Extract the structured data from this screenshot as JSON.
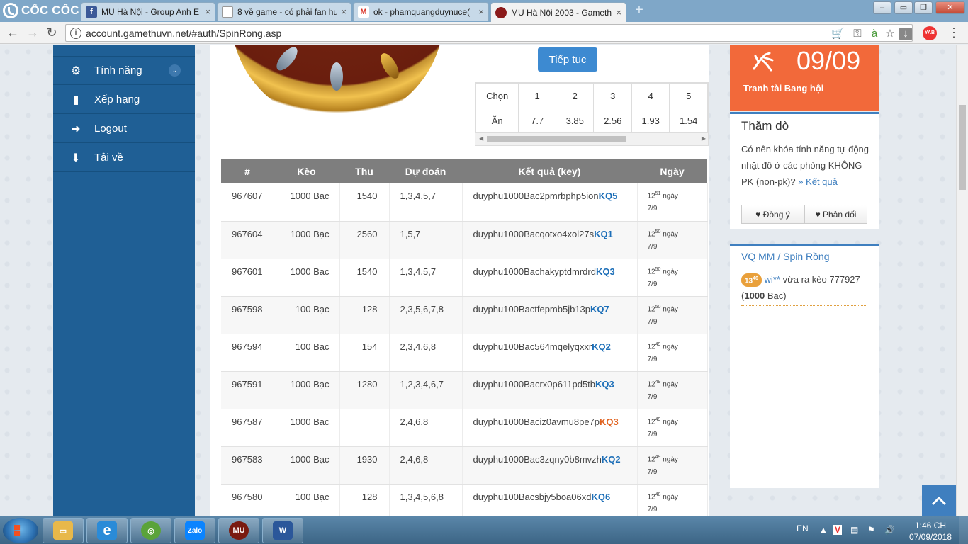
{
  "browser": {
    "brand": "CỐC CỐC",
    "tabs": [
      {
        "title": "MU Hà Nội - Group Anh E",
        "favicon": "facebook-icon",
        "color": "#3b5998",
        "glyph": "f"
      },
      {
        "title": "8 về game - có phải fan hu",
        "favicon": "page-icon",
        "color": "#ffffff",
        "glyph": "▯"
      },
      {
        "title": "ok - phamquangduynuce(",
        "favicon": "gmail-icon",
        "color": "#ffffff",
        "glyph": "M"
      },
      {
        "title": "MU Hà Nội 2003 - Gameth",
        "favicon": "mu-game-icon",
        "color": "#8b1a1a",
        "glyph": "●"
      }
    ],
    "url": "account.gamethuvn.net/#auth/SpinRong.asp",
    "new_tab": "+"
  },
  "sidebar": {
    "items": [
      {
        "label": "Tính năng",
        "icon": "⚙",
        "caret": "⌄"
      },
      {
        "label": "Xếp hạng",
        "icon": "▮"
      },
      {
        "label": "Logout",
        "icon": "➜"
      },
      {
        "label": "Tải về",
        "icon": "⬇"
      }
    ]
  },
  "spin": {
    "continue_label": "Tiếp tục",
    "odds": {
      "row1_label": "Chọn",
      "row2_label": "Ăn",
      "choices": [
        "1",
        "2",
        "3",
        "4",
        "5"
      ],
      "payouts": [
        "7.7",
        "3.85",
        "2.56",
        "1.93",
        "1.54"
      ]
    }
  },
  "history": {
    "columns": [
      "#",
      "Kèo",
      "Thu",
      "Dự đoán",
      "Kết quả (key)",
      "Ngày"
    ],
    "rows": [
      {
        "id": "967607",
        "bet": "1000 Bạc",
        "received": "1540",
        "prediction": "1,3,4,5,7",
        "key": "duyphu1000Bac2pmrbphp5ion",
        "result": "KQ5",
        "hour": "12",
        "minute": "51",
        "day_word": "ngày",
        "date": "7/9",
        "result_alt": false
      },
      {
        "id": "967604",
        "bet": "1000 Bạc",
        "received": "2560",
        "prediction": "1,5,7",
        "key": "duyphu1000Bacqotxo4xol27s",
        "result": "KQ1",
        "hour": "12",
        "minute": "50",
        "day_word": "ngày",
        "date": "7/9",
        "result_alt": false
      },
      {
        "id": "967601",
        "bet": "1000 Bạc",
        "received": "1540",
        "prediction": "1,3,4,5,7",
        "key": "duyphu1000Bachakyptdmrdrd",
        "result": "KQ3",
        "hour": "12",
        "minute": "50",
        "day_word": "ngày",
        "date": "7/9",
        "result_alt": false
      },
      {
        "id": "967598",
        "bet": "100 Bạc",
        "received": "128",
        "prediction": "2,3,5,6,7,8",
        "key": "duyphu100Bactfepmb5jb13p",
        "result": "KQ7",
        "hour": "12",
        "minute": "50",
        "day_word": "ngày",
        "date": "7/9",
        "result_alt": false
      },
      {
        "id": "967594",
        "bet": "100 Bạc",
        "received": "154",
        "prediction": "2,3,4,6,8",
        "key": "duyphu100Bac564mqelyqxxr",
        "result": "KQ2",
        "hour": "12",
        "minute": "49",
        "day_word": "ngày",
        "date": "7/9",
        "result_alt": false
      },
      {
        "id": "967591",
        "bet": "1000 Bạc",
        "received": "1280",
        "prediction": "1,2,3,4,6,7",
        "key": "duyphu1000Bacrx0p611pd5tb",
        "result": "KQ3",
        "hour": "12",
        "minute": "49",
        "day_word": "ngày",
        "date": "7/9",
        "result_alt": false
      },
      {
        "id": "967587",
        "bet": "1000 Bạc",
        "received": "",
        "prediction": "2,4,6,8",
        "key": "duyphu1000Baciz0avmu8pe7p",
        "result": "KQ3",
        "hour": "12",
        "minute": "49",
        "day_word": "ngày",
        "date": "7/9",
        "result_alt": true
      },
      {
        "id": "967583",
        "bet": "1000 Bạc",
        "received": "1930",
        "prediction": "2,4,6,8",
        "key": "duyphu1000Bac3zqny0b8mvzh",
        "result": "KQ2",
        "hour": "12",
        "minute": "49",
        "day_word": "ngày",
        "date": "7/9",
        "result_alt": false
      },
      {
        "id": "967580",
        "bet": "100 Bạc",
        "received": "128",
        "prediction": "1,3,4,5,6,8",
        "key": "duyphu100Bacsbjy5boa06xd",
        "result": "KQ6",
        "hour": "12",
        "minute": "48",
        "day_word": "ngày",
        "date": "7/9",
        "result_alt": false
      }
    ]
  },
  "event": {
    "date": "09/09",
    "label": "Tranh tài Bang hội"
  },
  "poll": {
    "title": "Thăm dò",
    "question": "Có nên khóa tính năng tự động nhặt đồ ở các phòng KHÔNG PK (non-pk)?",
    "result_link": "» Kết quả",
    "agree": "♥ Đồng ý",
    "disagree": "♥ Phản đối"
  },
  "feed": {
    "title_a": "VQ MM",
    "sep": " / ",
    "title_b": "Spin Rồng",
    "entry": {
      "hour": "13",
      "minute": "46",
      "user": "wi**",
      "text": "vừa ra kèo",
      "bet_id": "777927",
      "amount": "1000",
      "unit": "Bạc"
    }
  },
  "taskbar": {
    "lang": "EN",
    "time": "1:46 CH",
    "date": "07/09/2018",
    "apps": [
      {
        "name": "explorer-icon",
        "glyph": "▭",
        "color": "#e8b84a"
      },
      {
        "name": "ie-icon",
        "glyph": "e",
        "color": "#2a8bd8"
      },
      {
        "name": "coccoc-icon",
        "glyph": "◎",
        "color": "#5aa33a"
      },
      {
        "name": "zalo-icon",
        "glyph": "Zalo",
        "color": "#0a84ff"
      },
      {
        "name": "mu-icon",
        "glyph": "MU",
        "color": "#7a1a10"
      },
      {
        "name": "word-icon",
        "glyph": "W",
        "color": "#2b579a"
      }
    ]
  }
}
